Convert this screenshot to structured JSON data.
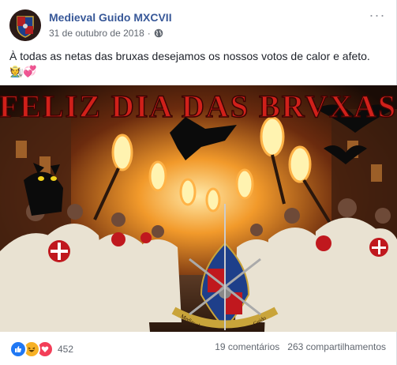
{
  "post": {
    "page_name": "Medieval Guido MXCVII",
    "date": "31 de outubro de 2018",
    "separator": "·",
    "audience_icon": "globe-icon",
    "more_label": "···",
    "text": "À todas as netas das bruxas desejamos os nossos votos de calor e afeto.",
    "emojis": "🧑‍🌾💞",
    "image": {
      "banner_text": "FELIZ DIA DAS BRVXAS",
      "emblem_left": "Medieval",
      "emblem_right": "Guido"
    }
  },
  "footer": {
    "reaction_icons": [
      "like-icon",
      "haha-icon",
      "love-icon"
    ],
    "reaction_count": "452",
    "comments": "19 comentários",
    "shares": "263 compartilhamentos"
  },
  "colors": {
    "link": "#385898",
    "meta": "#616770",
    "like": "#2078f4",
    "haha": "#f7b125",
    "love": "#f33e58"
  }
}
